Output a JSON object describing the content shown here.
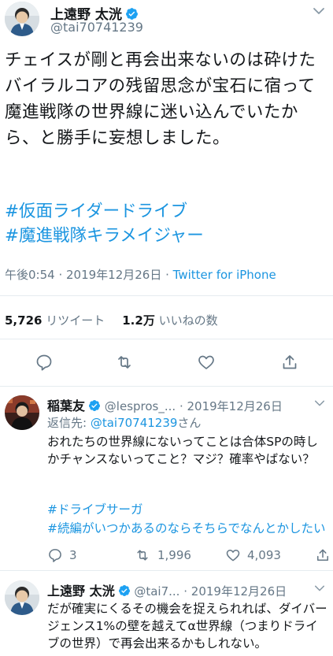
{
  "main_tweet": {
    "author_name": "上遠野 太洸",
    "author_handle": "@tai70741239",
    "text": "チェイスが剛と再会出来ないのは砕けたバイラルコアの残留思念が宝石に宿って魔進戦隊の世界線に迷い込んでいたから、と勝手に妄想しました。",
    "hashtags": [
      "#仮面ライダードライブ",
      "#魔進戦隊キラメイジャー"
    ],
    "timestamp": "午後0:54 · 2019年12月26日 ·",
    "source": "Twitter for iPhone",
    "retweets_count": "5,726",
    "retweets_label": "リツイート",
    "likes_count": "1.2万",
    "likes_label": "いいねの数"
  },
  "replies": [
    {
      "author_name": "稲葉友",
      "author_handle": "@lespros_...",
      "date": "· 2019年12月26日",
      "replying_prefix": "返信先: ",
      "replying_to": "@tai70741239",
      "replying_suffix": "さん",
      "text": "おれたちの世界線にないってことは合体SPの時しかチャンスないってこと？マジ？確率やばない？",
      "hashtags": [
        "#ドライブサーガ",
        "#続編がいつかあるのならそちらでなんとかしたい"
      ],
      "reply_count": "3",
      "retweet_count": "1,996",
      "like_count": "4,093"
    },
    {
      "author_name": "上遠野 太洸",
      "author_handle": "@tai7...",
      "date": "· 2019年12月26日",
      "text": "だが確実にくるその機会を捉えられれば、ダイバージェンス1%の壁を越えてα世界線（つまりドライブの世界）で再会出来るかもしれない。"
    }
  ],
  "colors": {
    "link": "#1b95e0",
    "secondary_text": "#657786",
    "divider": "#e6ecf0",
    "verified": "#1da1f2"
  }
}
